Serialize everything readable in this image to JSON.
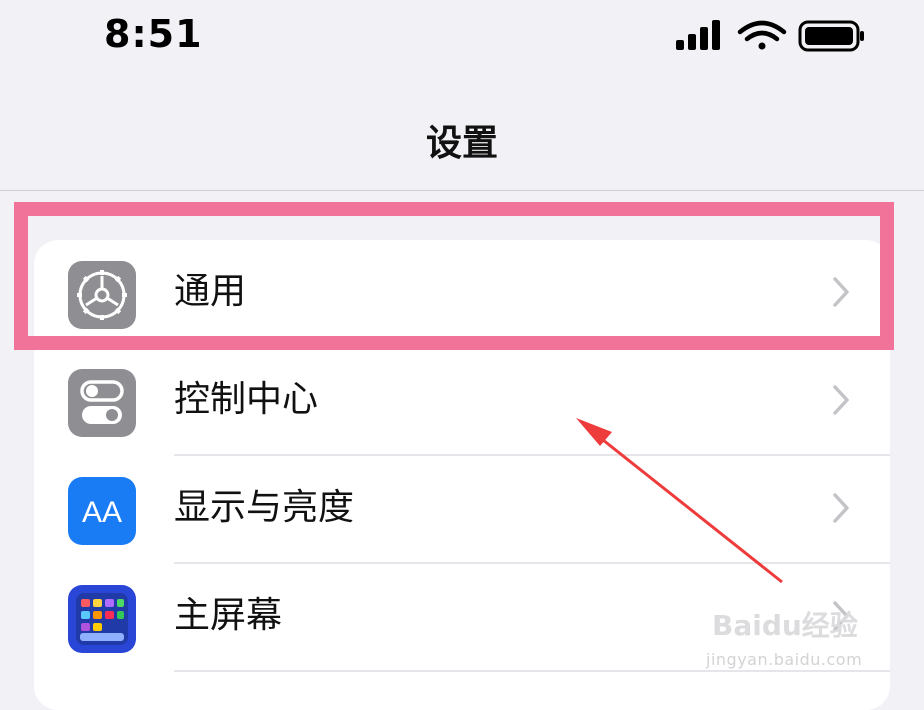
{
  "status_bar": {
    "time": "8:51",
    "icons": [
      "cellular-signal-icon",
      "wifi-icon",
      "battery-icon"
    ]
  },
  "nav": {
    "title": "设置"
  },
  "settings_items": [
    {
      "label": "通用",
      "icon": "gear-icon",
      "icon_color": "#8e8e93"
    },
    {
      "label": "控制中心",
      "icon": "toggles-icon",
      "icon_color": "#8e8e93"
    },
    {
      "label": "显示与亮度",
      "icon": "display-brightness-icon",
      "icon_color": "#1a7cf5",
      "icon_text": "AA"
    },
    {
      "label": "主屏幕",
      "icon": "home-screen-icon",
      "icon_color": "#2a46d6"
    }
  ],
  "annotation": {
    "highlight_color": "#f2739a",
    "arrow_color": "#ee3b3b"
  },
  "watermark": {
    "brand": "Baidu经验",
    "url": "jingyan.baidu.com"
  }
}
